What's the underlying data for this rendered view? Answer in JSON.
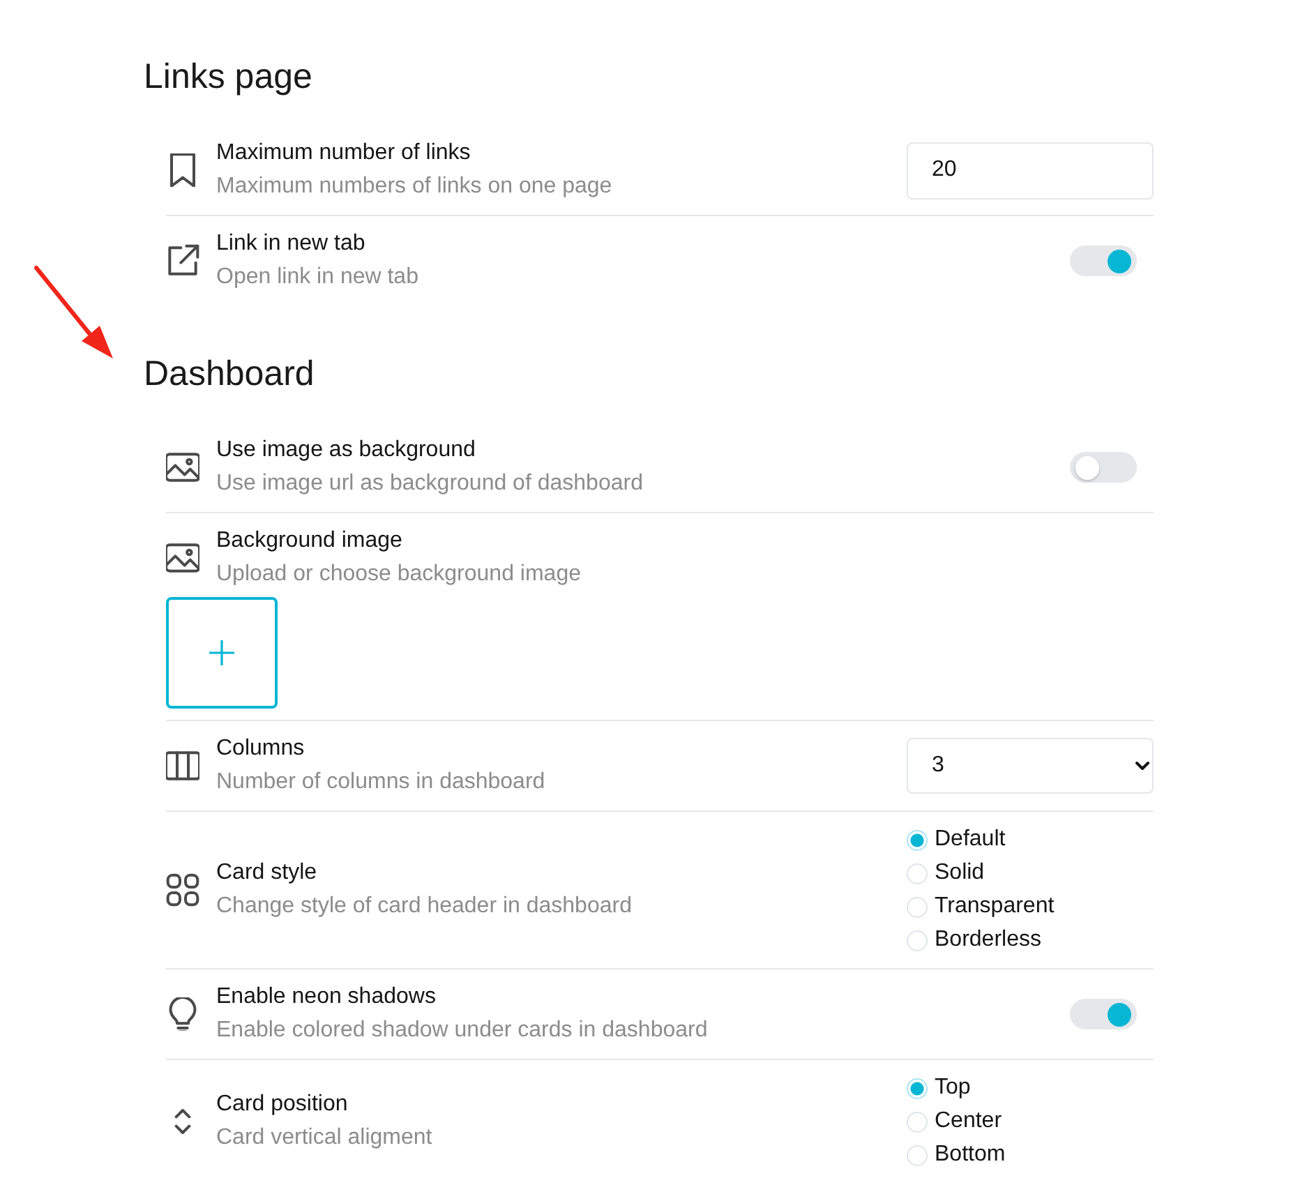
{
  "annotation": {
    "kind": "arrow"
  },
  "sections": [
    {
      "title": "Links page",
      "rows": [
        {
          "kind": "number",
          "title": "Maximum number of links",
          "description": "Maximum numbers of links on one page",
          "value": "20"
        },
        {
          "kind": "toggle",
          "title": "Link in new tab",
          "description": "Open link in new tab",
          "on": true
        }
      ]
    },
    {
      "title": "Dashboard",
      "rows": [
        {
          "kind": "toggle",
          "title": "Use image as background",
          "description": "Use image url as background of dashboard",
          "on": false
        },
        {
          "kind": "upload",
          "title": "Background image",
          "description": "Upload or choose background image"
        },
        {
          "kind": "select",
          "title": "Columns",
          "description": "Number of columns in dashboard",
          "value": "3"
        },
        {
          "kind": "radio",
          "title": "Card style",
          "description": "Change style of card header in dashboard",
          "options": [
            {
              "label": "Default",
              "selected": true
            },
            {
              "label": "Solid",
              "selected": false
            },
            {
              "label": "Transparent",
              "selected": false
            },
            {
              "label": "Borderless",
              "selected": false
            }
          ]
        },
        {
          "kind": "toggle",
          "title": "Enable neon shadows",
          "description": "Enable colored shadow under cards in dashboard",
          "on": true
        },
        {
          "kind": "radio",
          "title": "Card position",
          "description": "Card vertical aligment",
          "options": [
            {
              "label": "Top",
              "selected": true
            },
            {
              "label": "Center",
              "selected": false
            },
            {
              "label": "Bottom",
              "selected": false
            }
          ]
        }
      ]
    }
  ]
}
